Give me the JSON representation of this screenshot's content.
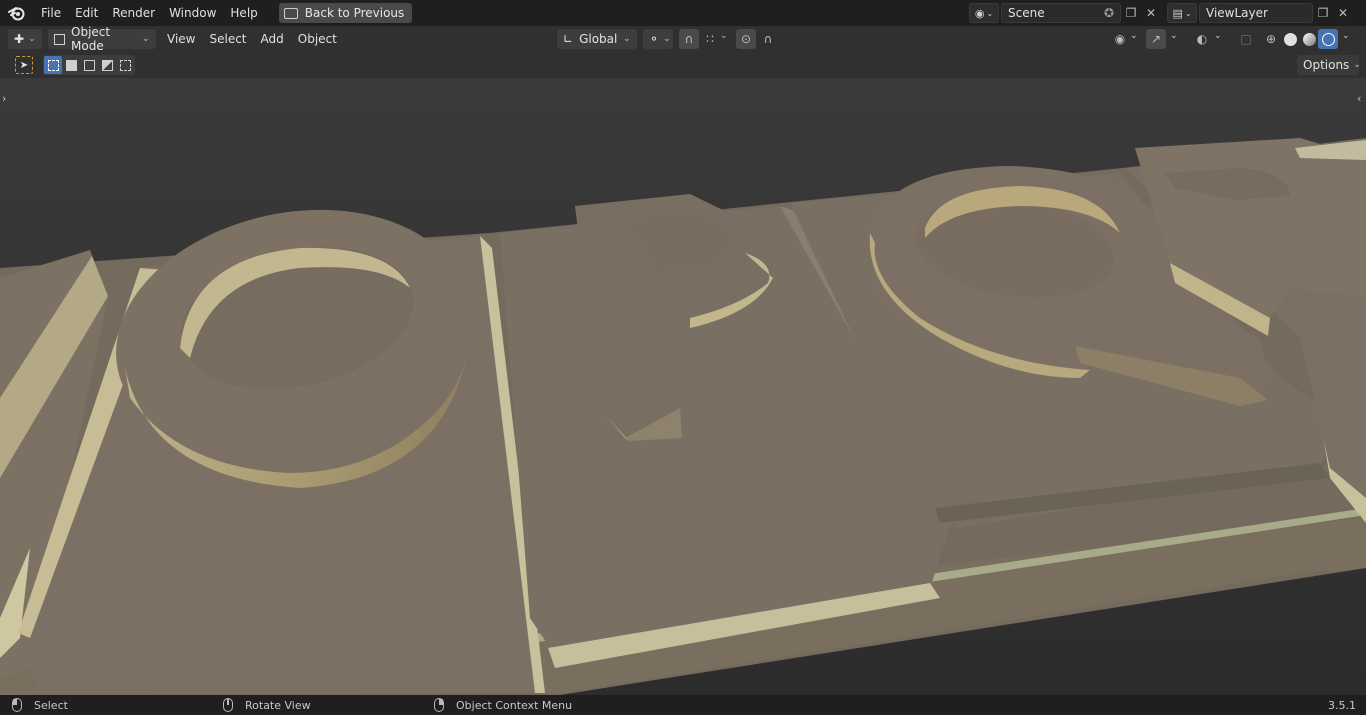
{
  "topbar": {
    "menus": [
      "File",
      "Edit",
      "Render",
      "Window",
      "Help"
    ],
    "back_button": "Back to Previous",
    "scene": "Scene",
    "view_layer": "ViewLayer"
  },
  "header": {
    "mode": "Object Mode",
    "menus": [
      "View",
      "Select",
      "Add",
      "Object"
    ],
    "orientation": "Global",
    "options": "Options"
  },
  "statusbar": {
    "select": "Select",
    "rotate": "Rotate View",
    "context": "Object Context Menu",
    "version": "3.5.1"
  },
  "colors": {
    "accent": "#4772b3",
    "tile": "#786c5f",
    "tile_light": "#bdb288",
    "background": "#3d3d3d"
  }
}
